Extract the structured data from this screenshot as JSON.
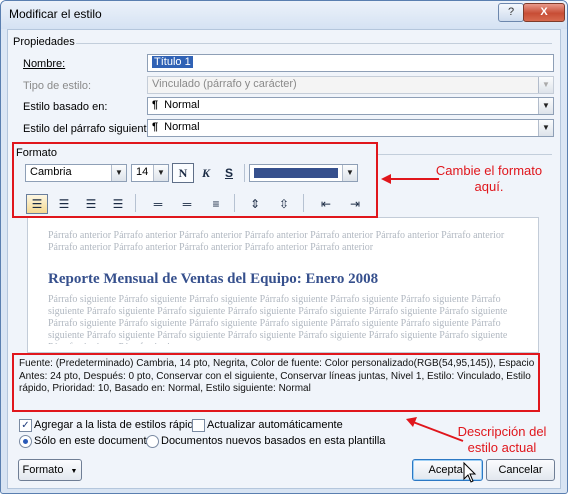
{
  "window": {
    "title": "Modificar el estilo",
    "help_label": "?",
    "close_label": "X"
  },
  "properties": {
    "group_label": "Propiedades",
    "name_label": "Nombre:",
    "name_value": "Título 1",
    "style_type_label": "Tipo de estilo:",
    "style_type_value": "Vinculado (párrafo y carácter)",
    "based_on_label": "Estilo basado en:",
    "based_on_value": "Normal",
    "next_style_label": "Estilo del párrafo siguiente:",
    "next_style_value": "Normal",
    "pilcrow": "¶"
  },
  "format": {
    "group_label": "Formato",
    "font_value": "Cambria",
    "size_value": "14",
    "bold_glyph": "N",
    "italic_glyph": "K",
    "underline_glyph": "S",
    "font_color": "#36508d"
  },
  "preview": {
    "previous_paragraph": "Párrafo anterior Párrafo anterior Párrafo anterior Párrafo anterior Párrafo anterior Párrafo anterior Párrafo anterior Párrafo anterior Párrafo anterior Párrafo anterior Párrafo anterior Párrafo anterior",
    "heading": "Reporte Mensual de Ventas del Equipo: Enero 2008",
    "next_paragraph": "Párrafo siguiente Párrafo siguiente Párrafo siguiente Párrafo siguiente Párrafo siguiente Párrafo siguiente Párrafo siguiente Párrafo siguiente Párrafo siguiente Párrafo siguiente Párrafo siguiente Párrafo siguiente Párrafo siguiente Párrafo siguiente Párrafo siguiente Párrafo siguiente Párrafo siguiente Párrafo siguiente Párrafo siguiente Párrafo siguiente Párrafo siguiente Párrafo siguiente Párrafo siguiente Párrafo siguiente Párrafo siguiente Párrafo siguiente Párrafo siguiente Párrafo siguiente"
  },
  "description": {
    "text": "Fuente: (Predeterminado) Cambria, 14 pto, Negrita, Color de fuente: Color personalizado(RGB(54,95,145)), Espacio Antes: 24 pto, Después: 0 pto, Conservar con el siguiente, Conservar líneas juntas, Nivel 1, Estilo: Vinculado, Estilo rápido, Prioridad: 10, Basado en: Normal, Estilo siguiente: Normal"
  },
  "options": {
    "quick_styles_label": "Agregar a la lista de estilos rápidos",
    "quick_styles_checked": true,
    "auto_update_label": "Actualizar automáticamente",
    "auto_update_checked": false,
    "only_this_doc_label": "Sólo en este documento",
    "new_docs_label": "Documentos nuevos basados en esta plantilla",
    "selected_scope": "only_this_doc"
  },
  "buttons": {
    "format_label": "Formato",
    "ok_label": "Aceptar",
    "cancel_label": "Cancelar"
  },
  "annotations": {
    "format_callout": "Cambie el formato aquí.",
    "description_callout": "Descripción del estilo actual",
    "highlight_color": "#e0161c"
  }
}
